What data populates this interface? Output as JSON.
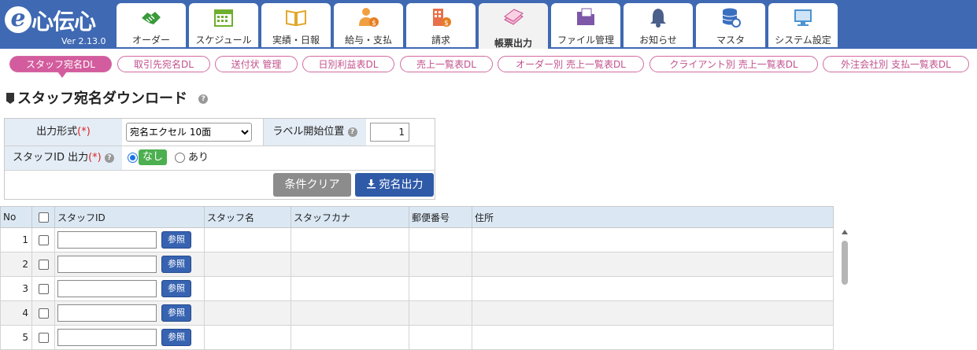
{
  "app": {
    "logo_e": "e",
    "logo_text": "心伝心",
    "version": "Ver 2.13.0"
  },
  "nav": {
    "tabs": [
      {
        "label": "オーダー",
        "icon": "handshake-icon"
      },
      {
        "label": "スケジュール",
        "icon": "calendar-icon"
      },
      {
        "label": "実績・日報",
        "icon": "open-book-icon"
      },
      {
        "label": "給与・支払",
        "icon": "person-money-icon"
      },
      {
        "label": "請求",
        "icon": "building-money-icon"
      },
      {
        "label": "帳票出力",
        "icon": "documents-icon",
        "active": true
      },
      {
        "label": "ファイル管理",
        "icon": "folder-icon"
      },
      {
        "label": "お知らせ",
        "icon": "bell-icon"
      },
      {
        "label": "マスタ",
        "icon": "database-icon"
      },
      {
        "label": "システム設定",
        "icon": "monitor-settings-icon"
      }
    ]
  },
  "subtabs": [
    {
      "label": "スタッフ宛名DL",
      "active": true
    },
    {
      "label": "取引先宛名DL"
    },
    {
      "label": "送付状 管理"
    },
    {
      "label": "日別利益表DL"
    },
    {
      "label": "売上一覧表DL"
    },
    {
      "label": "オーダー別 売上一覧表DL"
    },
    {
      "label": "クライアント別 売上一覧表DL"
    },
    {
      "label": "外注会社別 支払一覧表DL"
    }
  ],
  "page": {
    "title": "スタッフ宛名ダウンロード",
    "help": "?"
  },
  "form": {
    "output_format_label": "出力形式",
    "required_mark": "(*)",
    "output_format_value": "宛名エクセル 10面",
    "label_start_label": "ラベル開始位置",
    "label_start_value": "1",
    "staff_id_output_label": "スタッフID 出力",
    "radio_none": "なし",
    "radio_yes": "あり",
    "clear_button": "条件クリア",
    "output_button": "宛名出力"
  },
  "table": {
    "headers": {
      "no": "No",
      "staff_id": "スタッフID",
      "staff_name": "スタッフ名",
      "staff_kana": "スタッフカナ",
      "postal": "郵便番号",
      "address": "住所"
    },
    "ref_button": "参照",
    "rows": [
      "1",
      "2",
      "3",
      "4",
      "5"
    ]
  },
  "colors": {
    "header_bg": "#3f69b3",
    "accent_pink": "#d35c9e",
    "button_blue": "#2f5aa8",
    "button_gray": "#8c8c8c"
  }
}
